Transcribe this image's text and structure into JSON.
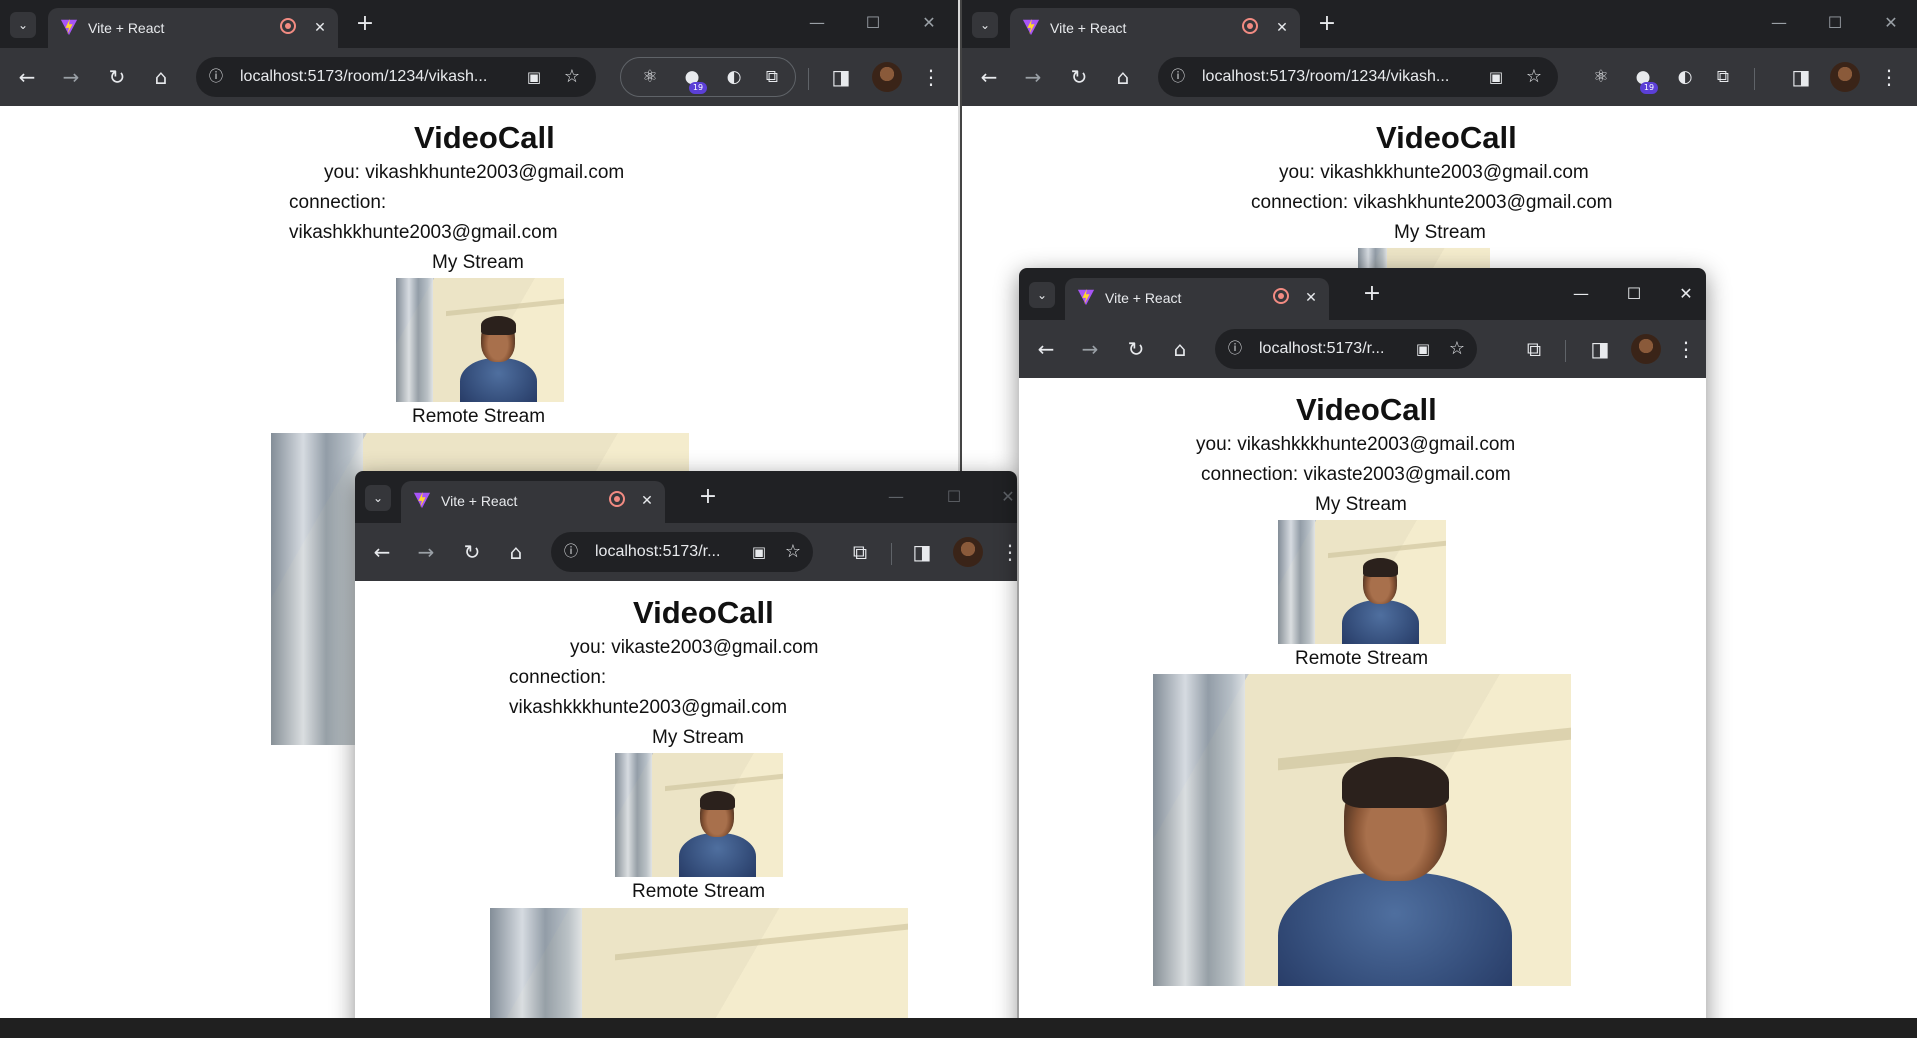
{
  "tab": {
    "title": "Vite + React"
  },
  "address": {
    "full": "localhost:5173/room/1234/vikash...",
    "short": "localhost:5173/r..."
  },
  "extensions": {
    "badge_count": "19"
  },
  "window_controls": {
    "minimize": "—",
    "maximize": "☐",
    "close": "✕"
  },
  "icons": {
    "tab_search": "chevron-down-icon",
    "new_tab": "plus-icon",
    "back": "back-arrow-icon",
    "forward": "forward-arrow-icon",
    "reload": "reload-icon",
    "home": "home-icon",
    "site_info": "info-icon",
    "camera": "camera-icon",
    "bookmark": "star-icon",
    "extensions": "puzzle-icon",
    "side_panel": "side-panel-icon",
    "menu": "kebab-menu-icon",
    "recording": "recording-indicator-icon"
  },
  "labels": {
    "my_stream": "My Stream",
    "remote_stream": "Remote Stream"
  },
  "windows": {
    "top_left": {
      "title": "VideoCall",
      "you": "you: vikashkhunte2003@gmail.com",
      "connection_label": "connection:",
      "connection_email": "vikashkkhunte2003@gmail.com"
    },
    "top_right": {
      "title": "VideoCall",
      "you": "you: vikashkkhunte2003@gmail.com",
      "connection": "connection: vikashkhunte2003@gmail.com"
    },
    "popup_left": {
      "title": "VideoCall",
      "you": "you: vikaste2003@gmail.com",
      "connection_label": "connection:",
      "connection_email": "vikashkkkhunte2003@gmail.com"
    },
    "popup_right": {
      "title": "VideoCall",
      "you": "you: vikashkkkhunte2003@gmail.com",
      "connection": "connection: vikaste2003@gmail.com"
    }
  },
  "colors": {
    "chrome_dark": "#202124",
    "chrome_toolbar": "#35363a",
    "record_dot": "#f28b82",
    "extension_badge": "#5b3fd6"
  }
}
